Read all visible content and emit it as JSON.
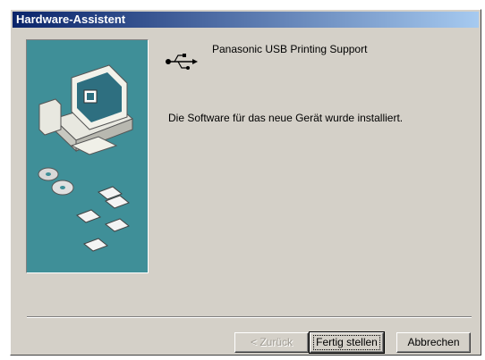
{
  "window": {
    "title": "Hardware-Assistent",
    "titlebar_color_start": "#0a246a",
    "titlebar_color_end": "#a6caf0"
  },
  "content": {
    "device_icon": "usb-icon",
    "device_name": "Panasonic USB Printing Support",
    "message": "Die Software für das neue Gerät wurde installiert."
  },
  "illustration": {
    "background_color": "#3f8f98",
    "icons": [
      "computer-icon",
      "cd-disc-icon",
      "floppy-disk-icon"
    ]
  },
  "buttons": {
    "back_label": "< Zurück",
    "finish_label": "Fertig stellen",
    "cancel_label": "Abbrechen"
  }
}
